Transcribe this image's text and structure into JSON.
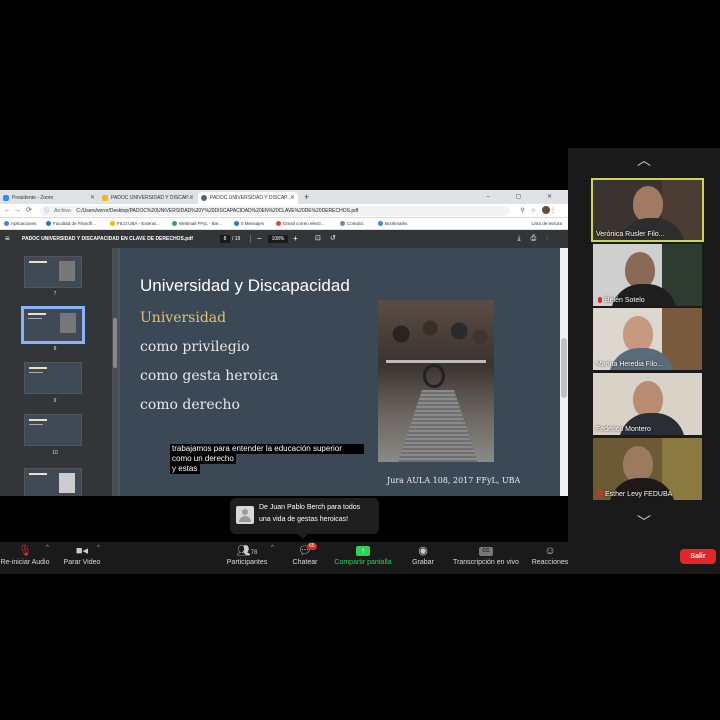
{
  "browser": {
    "tabs": [
      {
        "label": "Presidente - Zoom",
        "fav_color": "#2d8cff"
      },
      {
        "label": "PADOC UNIVERSIDAD Y DISCAP...",
        "fav_color": "#f6b900"
      },
      {
        "label": "PADOC UNIVERSIDAD Y DISCAP...",
        "fav_color": "#5f6368"
      }
    ],
    "new_tab": "+",
    "window_controls": "– ▢ ✕",
    "address_chip": "Archivo",
    "address": "C:/Users/veror/Desktop/PADOC%20UNIVERSIDAD%20Y%20DISCAPACIDAD%20EN%20CLAVE%20DE%20DERECHOS.pdf",
    "bookmarks": [
      {
        "label": "Aplicaciones",
        "color": "#4285f4"
      },
      {
        "label": "Facultad de Filosofí...",
        "color": "#1a73e8"
      },
      {
        "label": "FILO:UBA - Extensi...",
        "color": "#f6b900"
      },
      {
        "label": "Webmail FFyL - Bie...",
        "color": "#34a853"
      },
      {
        "label": "0 Mensajes",
        "color": "#1877f2"
      },
      {
        "label": "Gmail correo electr...",
        "color": "#ea4335"
      },
      {
        "label": "Comdoc",
        "color": "#888888"
      },
      {
        "label": "Bookmarks",
        "color": "#4285f4"
      }
    ],
    "reading_list": "Lista de lectura"
  },
  "pdf": {
    "title": "PADOC UNIVERSIDAD Y DISCAPACIDAD EN CLAVE DE DERECHOS.pdf",
    "current_page": "8",
    "total_pages": "/ 19",
    "zoom": "108%",
    "thumbnails": [
      "7",
      "8",
      "9",
      "10"
    ]
  },
  "slide": {
    "title": "Universidad y Discapacidad",
    "lines": [
      "Universidad",
      "como privilegio",
      "como gesta heroica",
      "como derecho"
    ],
    "caption": "Jura AULA 108, 2017 FFyL, UBA",
    "subtitles": [
      "trabajamos para entender la educación superior",
      "como un derecho",
      "y estas"
    ]
  },
  "chat_notification": {
    "from": "De Juan Pablo Berch para todos",
    "message": "una vida de gestas heroicas!"
  },
  "participants": [
    {
      "name": "Verónica Rusler Filo...",
      "muted": false,
      "active": true
    },
    {
      "name": "Belén Sotelo",
      "muted": true,
      "active": false
    },
    {
      "name": "Marina Heredia Filo...",
      "muted": false,
      "active": false
    },
    {
      "name": "Federico Montero",
      "muted": false,
      "active": false
    },
    {
      "name": "Esther Levy FEDUBA",
      "muted": true,
      "active": false
    }
  ],
  "toolbar": {
    "audio": "Re-iniciar Audio",
    "video": "Parar Video",
    "participants": "Participantes",
    "participants_count": "78",
    "chat": "Chatear",
    "chat_badge": "65",
    "share": "Compartir pantalla",
    "record": "Grabar",
    "transcript": "Transcripción en vivo",
    "cc": "CC",
    "reactions": "Reacciones",
    "leave": "Salir"
  }
}
